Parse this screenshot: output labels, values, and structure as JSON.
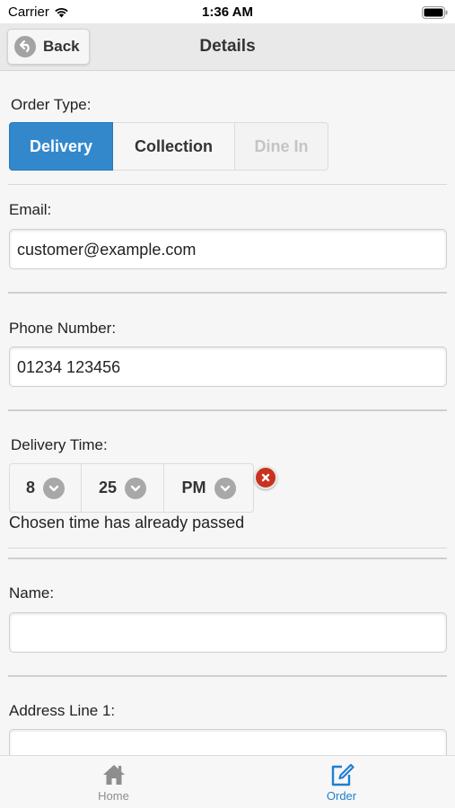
{
  "status_bar": {
    "carrier": "Carrier",
    "time": "1:36 AM"
  },
  "header": {
    "back_label": "Back",
    "title": "Details"
  },
  "order_type": {
    "label": "Order Type:",
    "options": [
      "Delivery",
      "Collection",
      "Dine In"
    ],
    "selected": "Delivery"
  },
  "email": {
    "label": "Email:",
    "value": "customer@example.com"
  },
  "phone": {
    "label": "Phone Number:",
    "value": "01234 123456"
  },
  "delivery_time": {
    "label": "Delivery Time:",
    "hour": "8",
    "minute": "25",
    "ampm": "PM",
    "error": "Chosen time has already passed"
  },
  "name": {
    "label": "Name:",
    "value": ""
  },
  "address1": {
    "label": "Address Line 1:",
    "value": ""
  },
  "tabbar": {
    "items": [
      {
        "label": "Home",
        "icon": "home-icon"
      },
      {
        "label": "Order",
        "icon": "edit-icon"
      }
    ],
    "active": "Order"
  },
  "colors": {
    "accent": "#3388cc",
    "error_icon": "#c8321e",
    "tab_active": "#1f7fd1",
    "tab_inactive": "#8e8e8e"
  }
}
